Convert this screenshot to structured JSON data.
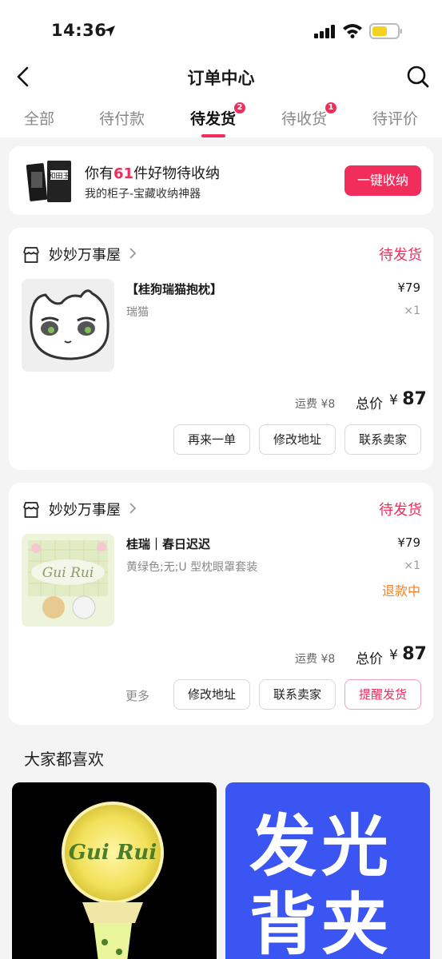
{
  "status_bar": {
    "time": "14:36"
  },
  "nav": {
    "title": "订单中心"
  },
  "tabs": [
    {
      "label": "全部",
      "badge": ""
    },
    {
      "label": "待付款",
      "badge": ""
    },
    {
      "label": "待发货",
      "badge": "2"
    },
    {
      "label": "待收货",
      "badge": "1"
    },
    {
      "label": "待评价",
      "badge": ""
    }
  ],
  "active_tab": "待发货",
  "promo": {
    "text_prefix": "你有",
    "count": "61",
    "text_suffix": "件好物待收纳",
    "subtitle": "我的柜子-宝藏收纳神器",
    "button": "一键收纳",
    "thumb_text": "和田玉"
  },
  "orders": [
    {
      "shop": "妙妙万事屋",
      "status": "待发货",
      "product_title": "【桂狗瑞猫抱枕】",
      "spec": "瑞猫",
      "price": "¥79",
      "qty": "×1",
      "refund": "",
      "shipping": "运费 ¥8",
      "total_label": "总价",
      "total_currency": "¥",
      "total_amount": "87",
      "buttons": [
        "再来一单",
        "修改地址",
        "联系卖家"
      ]
    },
    {
      "shop": "妙妙万事屋",
      "status": "待发货",
      "product_title": "桂瑞｜春日迟迟",
      "spec": "黄绿色;无;U 型枕眼罩套装",
      "price": "¥79",
      "qty": "×1",
      "refund": "退款中",
      "shipping": "运费 ¥8",
      "total_label": "总价",
      "total_currency": "¥",
      "total_amount": "87",
      "more": "更多",
      "buttons": [
        "修改地址",
        "联系卖家",
        "提醒发货"
      ]
    }
  ],
  "recommend": {
    "title": "大家都喜欢",
    "item2_text": [
      "发光",
      "背夹"
    ],
    "item1_text": "Gui Rui"
  },
  "colors": {
    "accent": "#f02d5b",
    "refund": "#f0822a",
    "blue": "#3a55f2"
  }
}
